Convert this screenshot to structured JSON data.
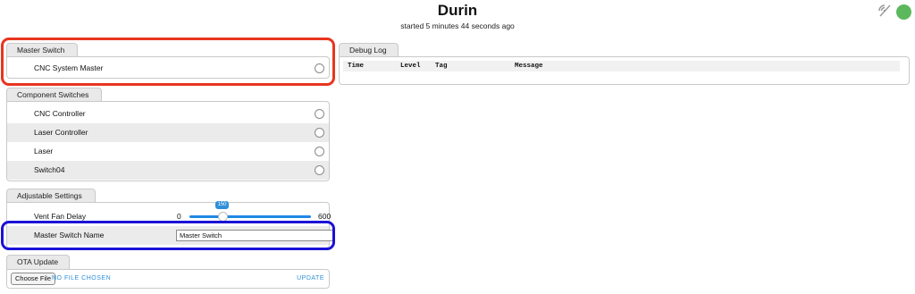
{
  "header": {
    "title": "Durin",
    "subtitle": "started 5 minutes 44 seconds ago",
    "connection_icon": "connection-disabled-icon",
    "status_color": "#5cb85c"
  },
  "master_switch": {
    "tab": "Master Switch",
    "items": [
      {
        "label": "CNC System Master"
      }
    ]
  },
  "component_switches": {
    "tab": "Component Switches",
    "items": [
      {
        "label": "CNC Controller"
      },
      {
        "label": "Laser Controller"
      },
      {
        "label": "Laser"
      },
      {
        "label": "Switch04"
      }
    ]
  },
  "adjustable_settings": {
    "tab": "Adjustable Settings",
    "vent_fan_delay": {
      "label": "Vent Fan Delay",
      "min": "0",
      "max": "600",
      "value": "150"
    },
    "master_switch_name": {
      "label": "Master Switch Name",
      "value": "Master Switch"
    }
  },
  "ota_update": {
    "tab": "OTA Update",
    "choose_file": "Choose File",
    "file_status": "NO FILE CHOSEN",
    "update": "UPDATE"
  },
  "debug_log": {
    "tab": "Debug Log",
    "columns": [
      "Time",
      "Level",
      "Tag",
      "Message"
    ]
  },
  "highlights": {
    "red": "#e8351f",
    "blue": "#1a12d6"
  }
}
